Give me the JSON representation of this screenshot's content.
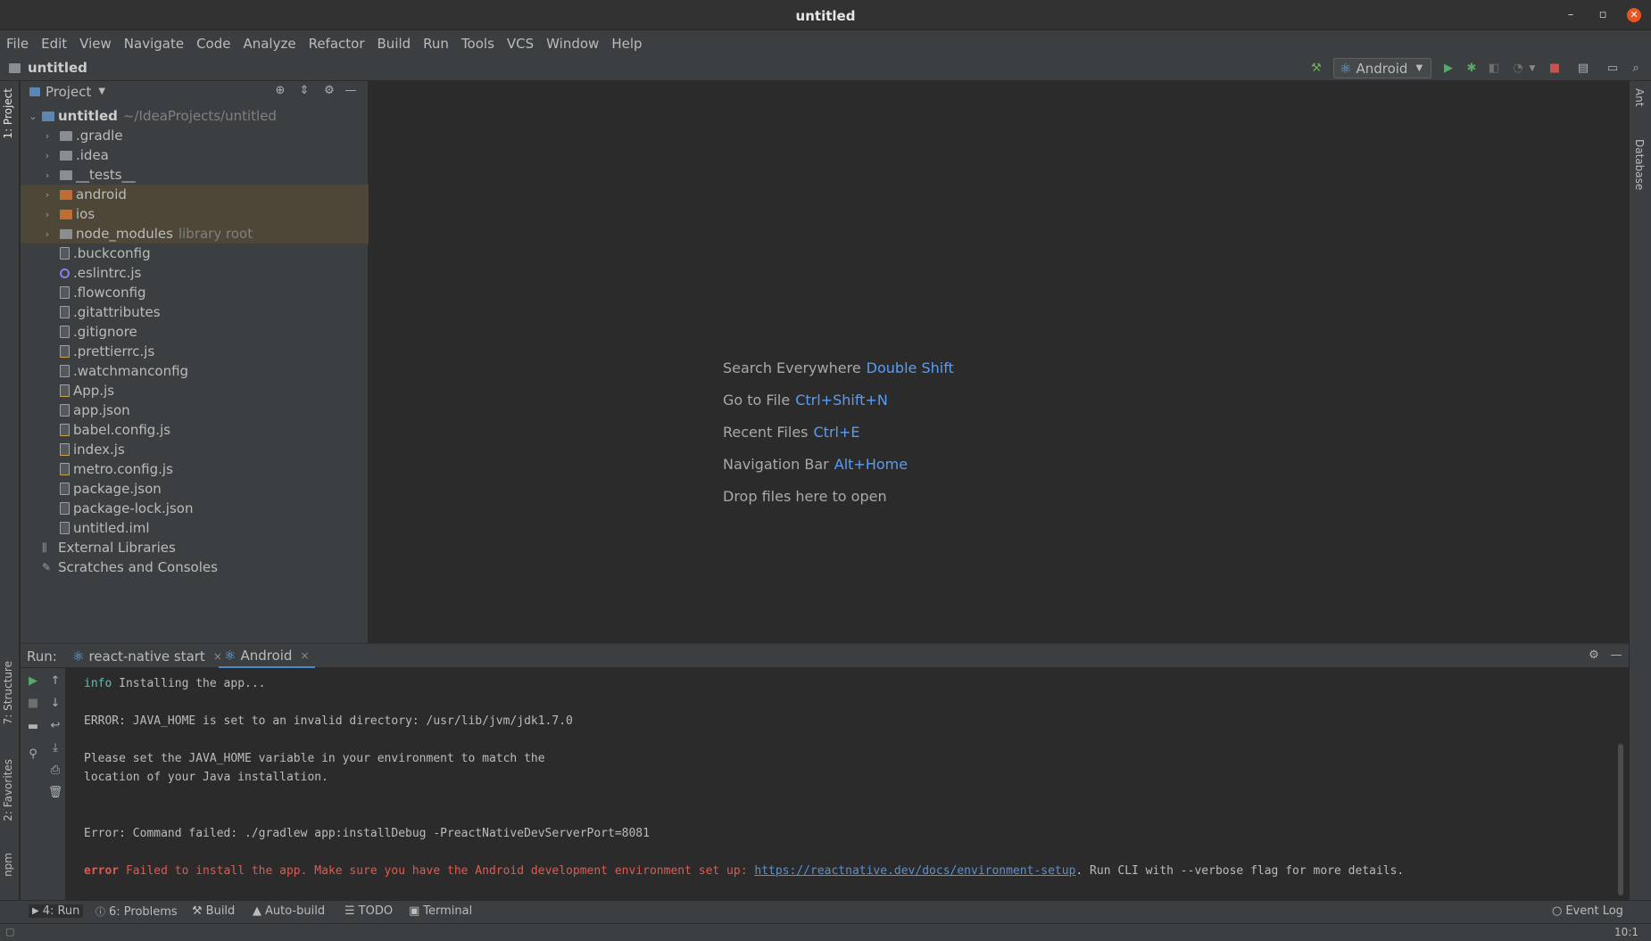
{
  "window": {
    "title": "untitled"
  },
  "menu": [
    "File",
    "Edit",
    "View",
    "Navigate",
    "Code",
    "Analyze",
    "Refactor",
    "Build",
    "Run",
    "Tools",
    "VCS",
    "Window",
    "Help"
  ],
  "navbar": {
    "project": "untitled",
    "run_config": "Android"
  },
  "project_panel": {
    "title": "Project",
    "root": {
      "name": "untitled",
      "path": "~/IdeaProjects/untitled"
    },
    "items": [
      {
        "name": ".gradle"
      },
      {
        "name": ".idea"
      },
      {
        "name": "__tests__"
      },
      {
        "name": "android"
      },
      {
        "name": "ios"
      },
      {
        "name": "node_modules",
        "hint": "library root"
      },
      {
        "name": ".buckconfig"
      },
      {
        "name": ".eslintrc.js"
      },
      {
        "name": ".flowconfig"
      },
      {
        "name": ".gitattributes"
      },
      {
        "name": ".gitignore"
      },
      {
        "name": ".prettierrc.js"
      },
      {
        "name": ".watchmanconfig"
      },
      {
        "name": "App.js"
      },
      {
        "name": "app.json"
      },
      {
        "name": "babel.config.js"
      },
      {
        "name": "index.js"
      },
      {
        "name": "metro.config.js"
      },
      {
        "name": "package.json"
      },
      {
        "name": "package-lock.json"
      },
      {
        "name": "untitled.iml"
      }
    ],
    "external_libraries": "External Libraries",
    "scratches": "Scratches and Consoles"
  },
  "editor_hints": [
    {
      "label": "Search Everywhere",
      "key": "Double Shift"
    },
    {
      "label": "Go to File",
      "key": "Ctrl+Shift+N"
    },
    {
      "label": "Recent Files",
      "key": "Ctrl+E"
    },
    {
      "label": "Navigation Bar",
      "key": "Alt+Home"
    },
    {
      "label": "Drop files here to open",
      "key": ""
    }
  ],
  "run": {
    "label": "Run:",
    "tabs": [
      "react-native start",
      "Android"
    ],
    "console": {
      "l1_prefix": "info",
      "l1_text": " Installing the app...",
      "l2": "ERROR: JAVA_HOME is set to an invalid directory: /usr/lib/jvm/jdk1.7.0",
      "l3": "Please set the JAVA_HOME variable in your environment to match the",
      "l4": "location of your Java installation.",
      "l5": "Error: Command failed: ./gradlew app:installDebug -PreactNativeDevServerPort=8081",
      "l6_prefix": "error",
      "l6_text": " Failed to install the app. Make sure you have the Android development environment set up: ",
      "l6_link": "https://reactnative.dev/docs/environment-setup",
      "l6_suffix": ". Run CLI with --verbose flag for more details."
    }
  },
  "left_strip": {
    "project": "1: Project",
    "structure": "7: Structure",
    "favorites": "2: Favorites",
    "npm": "npm"
  },
  "right_strip": {
    "ant": "Ant",
    "database": "Database"
  },
  "bottom_tabs": {
    "run": "4: Run",
    "problems": "6: Problems",
    "build": "Build",
    "autobuild": "Auto-build",
    "todo": "TODO",
    "terminal": "Terminal",
    "event_log": "Event Log"
  },
  "status": {
    "position": "10:1"
  }
}
